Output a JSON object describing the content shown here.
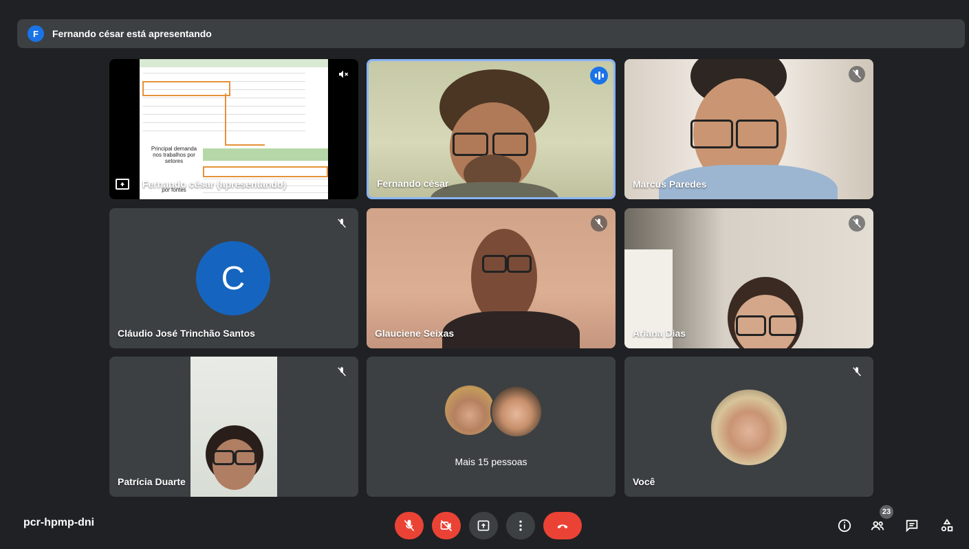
{
  "banner": {
    "avatar_letter": "F",
    "text": "Fernando césar está apresentando"
  },
  "tiles": {
    "presentation": {
      "label": "Fernando césar (apresentando)",
      "slide_caption_1": "Principal demanda nos trabalhos por setores",
      "slide_caption_2": "por fontes"
    },
    "fernando": {
      "name": "Fernando césar"
    },
    "marcus": {
      "name": "Marcus Paredes"
    },
    "claudio": {
      "name": "Cláudio José Trinchão Santos",
      "avatar_letter": "C"
    },
    "glauciene": {
      "name": "Glauciene Seixas"
    },
    "ariana": {
      "name": "Ariana Dias"
    },
    "patricia": {
      "name": "Patrícia Duarte"
    },
    "more": {
      "text": "Mais 15 pessoas"
    },
    "you": {
      "name": "Você"
    }
  },
  "bottom_bar": {
    "meeting_code": "pcr-hpmp-dni",
    "participants_count": "23",
    "controls": [
      "mic-off-button",
      "camera-off-button",
      "present-now-button",
      "more-options-button",
      "leave-call-button"
    ],
    "side_icons": [
      "info-icon",
      "people-icon",
      "chat-icon",
      "activities-icon"
    ]
  },
  "colors": {
    "background": "#202124",
    "tile": "#3c4043",
    "accent_blue": "#1a73e8",
    "danger_red": "#ea4335"
  }
}
